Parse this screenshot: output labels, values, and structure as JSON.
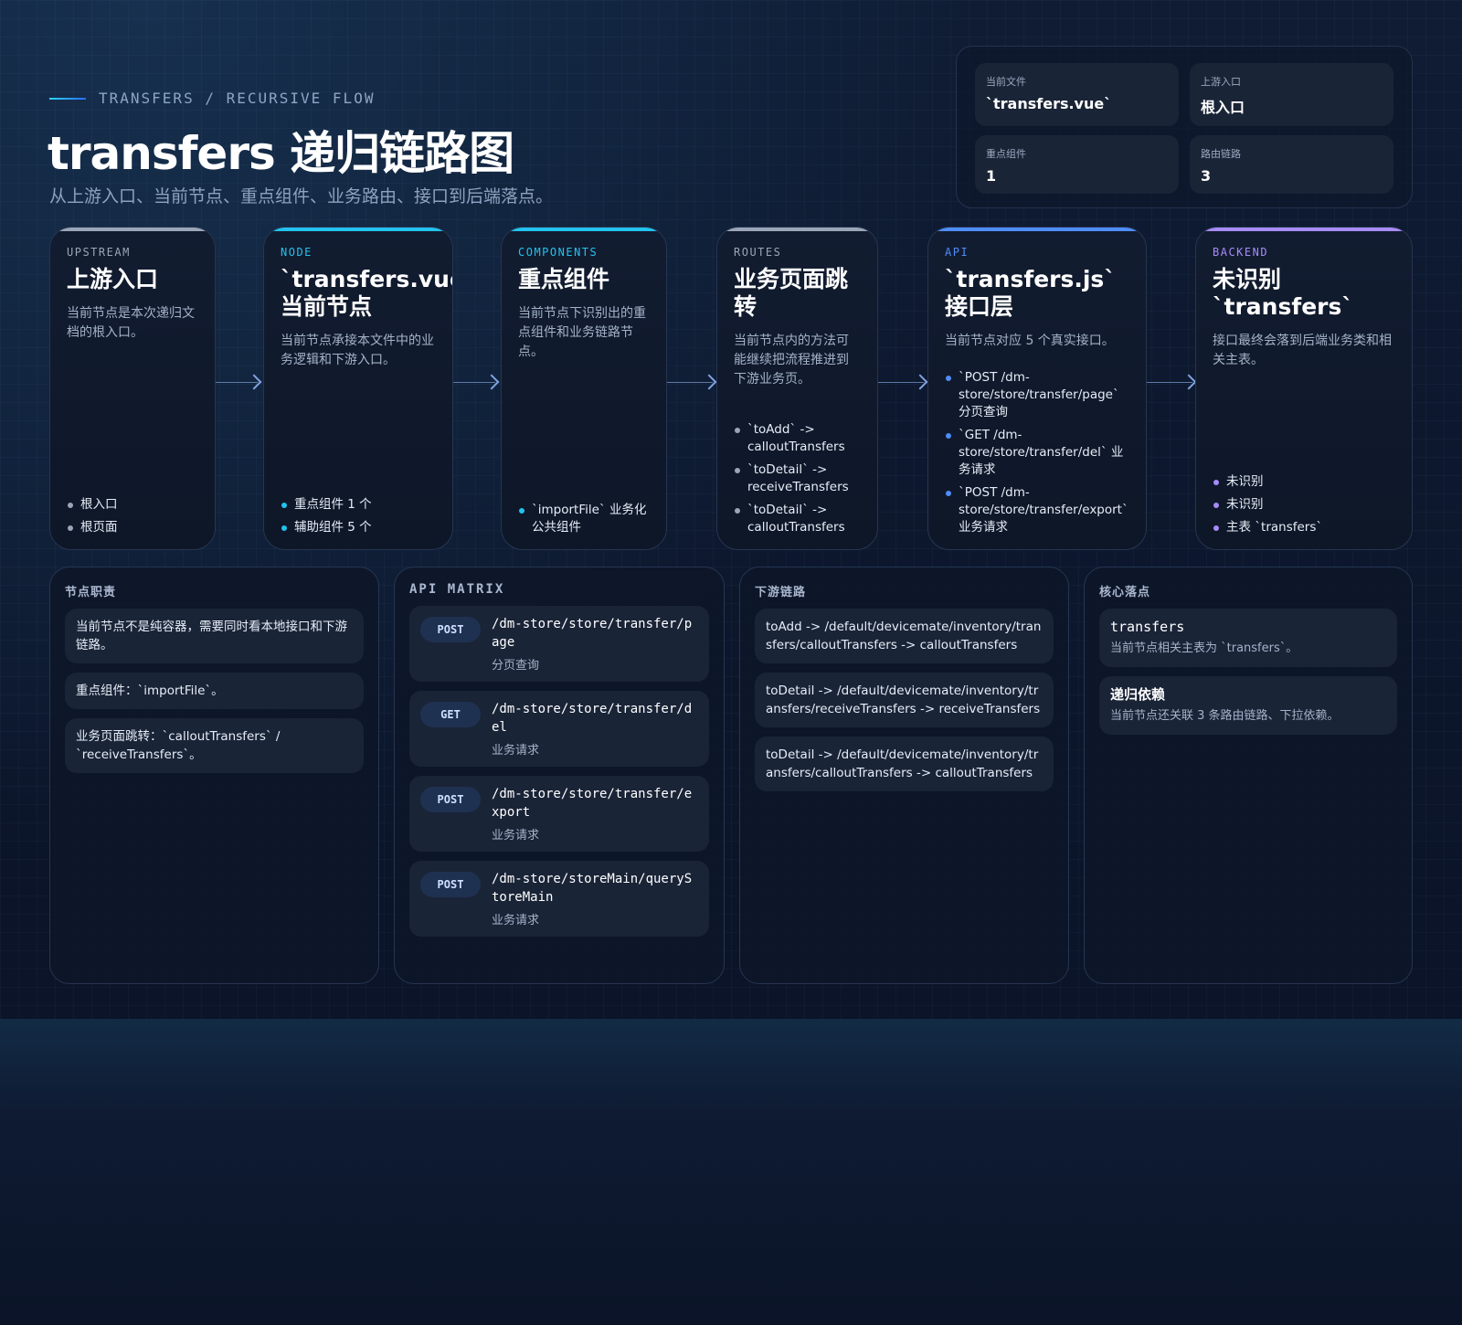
{
  "header": {
    "eyebrow": "TRANSFERS / RECURSIVE FLOW",
    "title": "transfers 递归链路图",
    "subtitle": "从上游入口、当前节点、重点组件、业务路由、接口到后端落点。"
  },
  "meta": [
    {
      "label": "当前文件",
      "value": "`transfers.vue`"
    },
    {
      "label": "上游入口",
      "value": "根入口"
    },
    {
      "label": "重点组件",
      "value": "1"
    },
    {
      "label": "路由链路",
      "value": "3"
    }
  ],
  "colors": {
    "upstream": "#9aa6b8",
    "node": "#22c3ee",
    "components": "#22c3ee",
    "routes": "#9aa6b8",
    "api": "#4f8df7",
    "backend": "#a78bfa"
  },
  "flow": [
    {
      "tag": "UPSTREAM",
      "title": "上游入口",
      "desc": "当前节点是本次递归文档的根入口。",
      "items": [
        "根入口",
        "根页面"
      ]
    },
    {
      "tag": "NODE",
      "title": "`transfers.vue` 当前节点",
      "desc": "当前节点承接本文件中的业务逻辑和下游入口。",
      "items": [
        "重点组件 1 个",
        "辅助组件 5 个"
      ]
    },
    {
      "tag": "COMPONENTS",
      "title": "重点组件",
      "desc": "当前节点下识别出的重点组件和业务链路节点。",
      "items": [
        "`importFile` 业务化公共组件"
      ]
    },
    {
      "tag": "ROUTES",
      "title": "业务页面跳转",
      "desc": "当前节点内的方法可能继续把流程推进到下游业务页。",
      "items": [
        "`toAdd` -> calloutTransfers",
        "`toDetail` -> receiveTransfers",
        "`toDetail` -> calloutTransfers"
      ]
    },
    {
      "tag": "API",
      "title": "`transfers.js` 接口层",
      "desc": "当前节点对应 5 个真实接口。",
      "items": [
        "`POST /dm-store/store/transfer/page` 分页查询",
        "`GET /dm-store/store/transfer/del` 业务请求",
        "`POST /dm-store/store/transfer/export` 业务请求"
      ]
    },
    {
      "tag": "BACKEND",
      "title": "未识别 `transfers`",
      "desc": "接口最终会落到后端业务类和相关主表。",
      "items": [
        "未识别",
        "未识别",
        "主表 `transfers`"
      ]
    }
  ],
  "panels": {
    "duty": {
      "title": "节点职责",
      "items": [
        "当前节点不是纯容器，需要同时看本地接口和下游链路。",
        "重点组件：`importFile`。",
        "业务页面跳转：`calloutTransfers` / `receiveTransfers`。"
      ]
    },
    "api": {
      "title": "API MATRIX",
      "items": [
        {
          "method": "POST",
          "path": "/dm-store/store/transfer/page",
          "note": "分页查询"
        },
        {
          "method": "GET",
          "path": "/dm-store/store/transfer/del",
          "note": "业务请求"
        },
        {
          "method": "POST",
          "path": "/dm-store/store/transfer/export",
          "note": "业务请求"
        },
        {
          "method": "POST",
          "path": "/dm-store/storeMain/queryStoreMain",
          "note": "业务请求"
        }
      ]
    },
    "downstream": {
      "title": "下游链路",
      "items": [
        "toAdd -> /default/devicemate/inventory/transfers/calloutTransfers -> calloutTransfers",
        "toDetail -> /default/devicemate/inventory/transfers/receiveTransfers -> receiveTransfers",
        "toDetail -> /default/devicemate/inventory/transfers/calloutTransfers -> calloutTransfers"
      ]
    },
    "core": {
      "title": "核心落点",
      "items": [
        {
          "head": "transfers",
          "desc": "当前节点相关主表为 `transfers`。"
        },
        {
          "head": "递归依赖",
          "desc": "当前节点还关联 3 条路由链路、下拉依赖。"
        }
      ]
    }
  }
}
